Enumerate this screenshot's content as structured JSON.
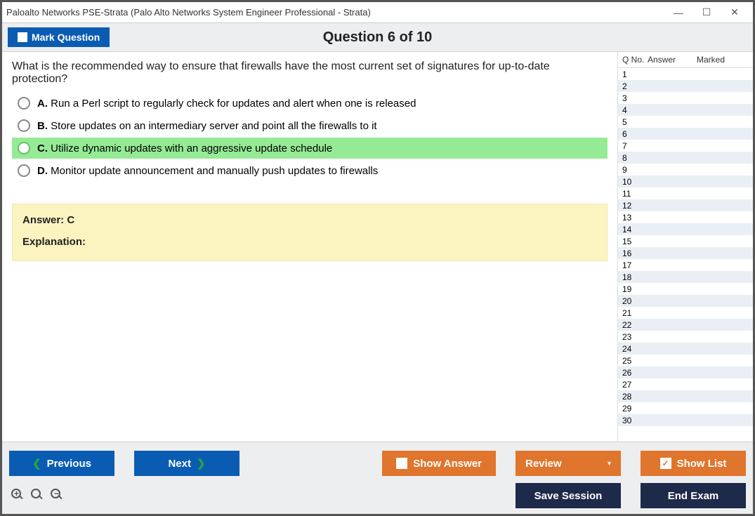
{
  "window": {
    "title": "Paloalto Networks PSE-Strata (Palo Alto Networks System Engineer Professional - Strata)"
  },
  "header": {
    "mark_label": "Mark Question",
    "question_title": "Question 6 of 10"
  },
  "question": {
    "text": "What is the recommended way to ensure that firewalls have the most current set of signatures for up-to-date protection?",
    "options": [
      {
        "letter": "A.",
        "text": "Run a Perl script to regularly check for updates and alert when one is released",
        "selected": false
      },
      {
        "letter": "B.",
        "text": "Store updates on an intermediary server and point all the firewalls to it",
        "selected": false
      },
      {
        "letter": "C.",
        "text": "Utilize dynamic updates with an aggressive update schedule",
        "selected": true
      },
      {
        "letter": "D.",
        "text": "Monitor update announcement and manually push updates to firewalls",
        "selected": false
      }
    ],
    "answer_label": "Answer:",
    "answer_value": "C",
    "explanation_label": "Explanation:"
  },
  "side": {
    "h_qno": "Q No.",
    "h_answer": "Answer",
    "h_marked": "Marked",
    "rows": [
      1,
      2,
      3,
      4,
      5,
      6,
      7,
      8,
      9,
      10,
      11,
      12,
      13,
      14,
      15,
      16,
      17,
      18,
      19,
      20,
      21,
      22,
      23,
      24,
      25,
      26,
      27,
      28,
      29,
      30
    ]
  },
  "footer": {
    "previous": "Previous",
    "next": "Next",
    "show_answer": "Show Answer",
    "review": "Review",
    "show_list": "Show List",
    "save_session": "Save Session",
    "end_exam": "End Exam"
  }
}
